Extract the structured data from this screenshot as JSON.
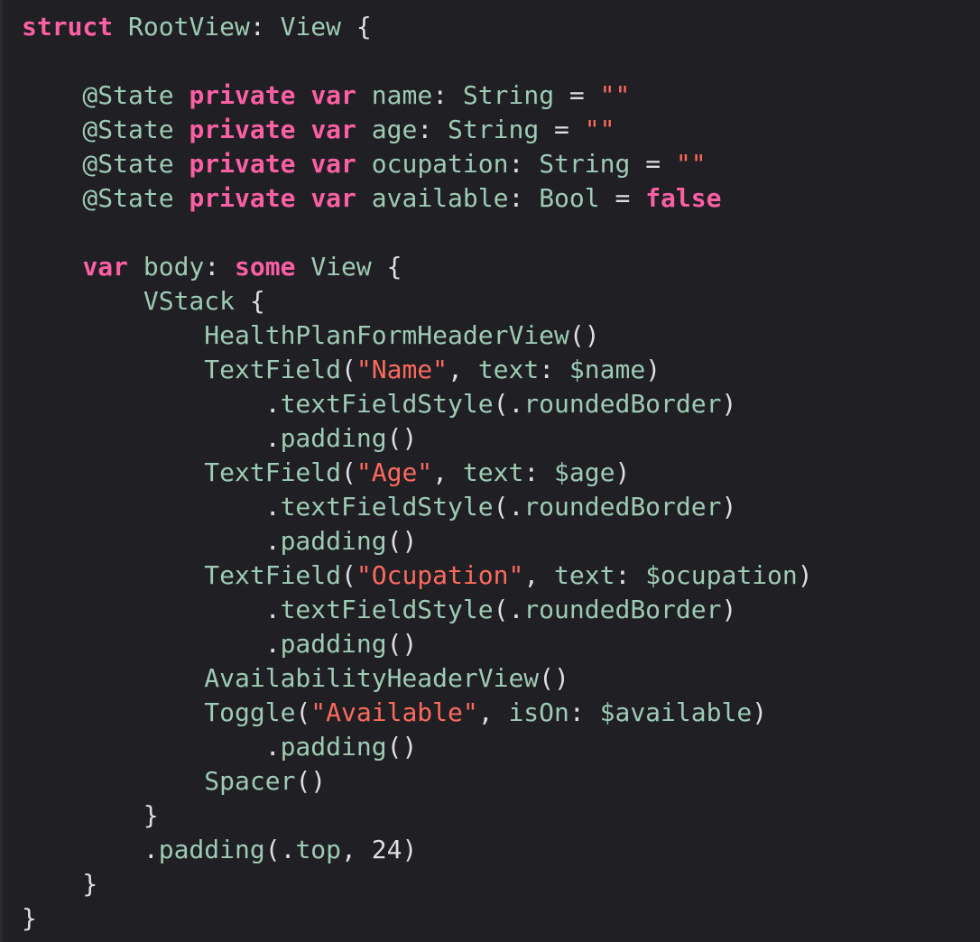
{
  "colors": {
    "background": "#1f1f24",
    "keyword": "#fc5fa3",
    "identifier": "#9ecbb4",
    "string": "#fc6a5d",
    "plain": "#dfdfe0"
  },
  "code": {
    "lines": [
      [
        {
          "t": "struct",
          "c": "kw"
        },
        {
          "t": " RootView",
          "c": "type"
        },
        {
          "t": ": ",
          "c": "plain"
        },
        {
          "t": "View",
          "c": "type"
        },
        {
          "t": " {",
          "c": "plain"
        }
      ],
      [],
      [
        {
          "t": "    @State",
          "c": "attr"
        },
        {
          "t": " ",
          "c": "plain"
        },
        {
          "t": "private",
          "c": "kw"
        },
        {
          "t": " ",
          "c": "plain"
        },
        {
          "t": "var",
          "c": "kw"
        },
        {
          "t": " name",
          "c": "var"
        },
        {
          "t": ": ",
          "c": "plain"
        },
        {
          "t": "String",
          "c": "type"
        },
        {
          "t": " = ",
          "c": "plain"
        },
        {
          "t": "\"\"",
          "c": "str"
        }
      ],
      [
        {
          "t": "    @State",
          "c": "attr"
        },
        {
          "t": " ",
          "c": "plain"
        },
        {
          "t": "private",
          "c": "kw"
        },
        {
          "t": " ",
          "c": "plain"
        },
        {
          "t": "var",
          "c": "kw"
        },
        {
          "t": " age",
          "c": "var"
        },
        {
          "t": ": ",
          "c": "plain"
        },
        {
          "t": "String",
          "c": "type"
        },
        {
          "t": " = ",
          "c": "plain"
        },
        {
          "t": "\"\"",
          "c": "str"
        }
      ],
      [
        {
          "t": "    @State",
          "c": "attr"
        },
        {
          "t": " ",
          "c": "plain"
        },
        {
          "t": "private",
          "c": "kw"
        },
        {
          "t": " ",
          "c": "plain"
        },
        {
          "t": "var",
          "c": "kw"
        },
        {
          "t": " ocupation",
          "c": "var"
        },
        {
          "t": ": ",
          "c": "plain"
        },
        {
          "t": "String",
          "c": "type"
        },
        {
          "t": " = ",
          "c": "plain"
        },
        {
          "t": "\"\"",
          "c": "str"
        }
      ],
      [
        {
          "t": "    @State",
          "c": "attr"
        },
        {
          "t": " ",
          "c": "plain"
        },
        {
          "t": "private",
          "c": "kw"
        },
        {
          "t": " ",
          "c": "plain"
        },
        {
          "t": "var",
          "c": "kw"
        },
        {
          "t": " available",
          "c": "var"
        },
        {
          "t": ": ",
          "c": "plain"
        },
        {
          "t": "Bool",
          "c": "type"
        },
        {
          "t": " = ",
          "c": "plain"
        },
        {
          "t": "false",
          "c": "kw"
        }
      ],
      [],
      [
        {
          "t": "    ",
          "c": "plain"
        },
        {
          "t": "var",
          "c": "kw"
        },
        {
          "t": " body",
          "c": "var"
        },
        {
          "t": ": ",
          "c": "plain"
        },
        {
          "t": "some",
          "c": "kw"
        },
        {
          "t": " View",
          "c": "type"
        },
        {
          "t": " {",
          "c": "plain"
        }
      ],
      [
        {
          "t": "        VStack",
          "c": "type"
        },
        {
          "t": " {",
          "c": "plain"
        }
      ],
      [
        {
          "t": "            HealthPlanFormHeaderView",
          "c": "type"
        },
        {
          "t": "()",
          "c": "plain"
        }
      ],
      [
        {
          "t": "            TextField",
          "c": "type"
        },
        {
          "t": "(",
          "c": "plain"
        },
        {
          "t": "\"Name\"",
          "c": "str"
        },
        {
          "t": ", ",
          "c": "plain"
        },
        {
          "t": "text",
          "c": "var"
        },
        {
          "t": ": ",
          "c": "plain"
        },
        {
          "t": "$name",
          "c": "var"
        },
        {
          "t": ")",
          "c": "plain"
        }
      ],
      [
        {
          "t": "                .",
          "c": "plain"
        },
        {
          "t": "textFieldStyle",
          "c": "var"
        },
        {
          "t": "(.",
          "c": "plain"
        },
        {
          "t": "roundedBorder",
          "c": "var"
        },
        {
          "t": ")",
          "c": "plain"
        }
      ],
      [
        {
          "t": "                .",
          "c": "plain"
        },
        {
          "t": "padding",
          "c": "var"
        },
        {
          "t": "()",
          "c": "plain"
        }
      ],
      [
        {
          "t": "            TextField",
          "c": "type"
        },
        {
          "t": "(",
          "c": "plain"
        },
        {
          "t": "\"Age\"",
          "c": "str"
        },
        {
          "t": ", ",
          "c": "plain"
        },
        {
          "t": "text",
          "c": "var"
        },
        {
          "t": ": ",
          "c": "plain"
        },
        {
          "t": "$age",
          "c": "var"
        },
        {
          "t": ")",
          "c": "plain"
        }
      ],
      [
        {
          "t": "                .",
          "c": "plain"
        },
        {
          "t": "textFieldStyle",
          "c": "var"
        },
        {
          "t": "(.",
          "c": "plain"
        },
        {
          "t": "roundedBorder",
          "c": "var"
        },
        {
          "t": ")",
          "c": "plain"
        }
      ],
      [
        {
          "t": "                .",
          "c": "plain"
        },
        {
          "t": "padding",
          "c": "var"
        },
        {
          "t": "()",
          "c": "plain"
        }
      ],
      [
        {
          "t": "            TextField",
          "c": "type"
        },
        {
          "t": "(",
          "c": "plain"
        },
        {
          "t": "\"Ocupation\"",
          "c": "str"
        },
        {
          "t": ", ",
          "c": "plain"
        },
        {
          "t": "text",
          "c": "var"
        },
        {
          "t": ": ",
          "c": "plain"
        },
        {
          "t": "$ocupation",
          "c": "var"
        },
        {
          "t": ")",
          "c": "plain"
        }
      ],
      [
        {
          "t": "                .",
          "c": "plain"
        },
        {
          "t": "textFieldStyle",
          "c": "var"
        },
        {
          "t": "(.",
          "c": "plain"
        },
        {
          "t": "roundedBorder",
          "c": "var"
        },
        {
          "t": ")",
          "c": "plain"
        }
      ],
      [
        {
          "t": "                .",
          "c": "plain"
        },
        {
          "t": "padding",
          "c": "var"
        },
        {
          "t": "()",
          "c": "plain"
        }
      ],
      [
        {
          "t": "            AvailabilityHeaderView",
          "c": "type"
        },
        {
          "t": "()",
          "c": "plain"
        }
      ],
      [
        {
          "t": "            Toggle",
          "c": "type"
        },
        {
          "t": "(",
          "c": "plain"
        },
        {
          "t": "\"Available\"",
          "c": "str"
        },
        {
          "t": ", ",
          "c": "plain"
        },
        {
          "t": "isOn",
          "c": "var"
        },
        {
          "t": ": ",
          "c": "plain"
        },
        {
          "t": "$available",
          "c": "var"
        },
        {
          "t": ")",
          "c": "plain"
        }
      ],
      [
        {
          "t": "                .",
          "c": "plain"
        },
        {
          "t": "padding",
          "c": "var"
        },
        {
          "t": "()",
          "c": "plain"
        }
      ],
      [
        {
          "t": "            Spacer",
          "c": "type"
        },
        {
          "t": "()",
          "c": "plain"
        }
      ],
      [
        {
          "t": "        }",
          "c": "plain"
        }
      ],
      [
        {
          "t": "        .",
          "c": "plain"
        },
        {
          "t": "padding",
          "c": "var"
        },
        {
          "t": "(.",
          "c": "plain"
        },
        {
          "t": "top",
          "c": "var"
        },
        {
          "t": ", ",
          "c": "plain"
        },
        {
          "t": "24",
          "c": "plain"
        },
        {
          "t": ")",
          "c": "plain"
        }
      ],
      [
        {
          "t": "    }",
          "c": "plain"
        }
      ],
      [
        {
          "t": "}",
          "c": "plain"
        }
      ]
    ]
  }
}
